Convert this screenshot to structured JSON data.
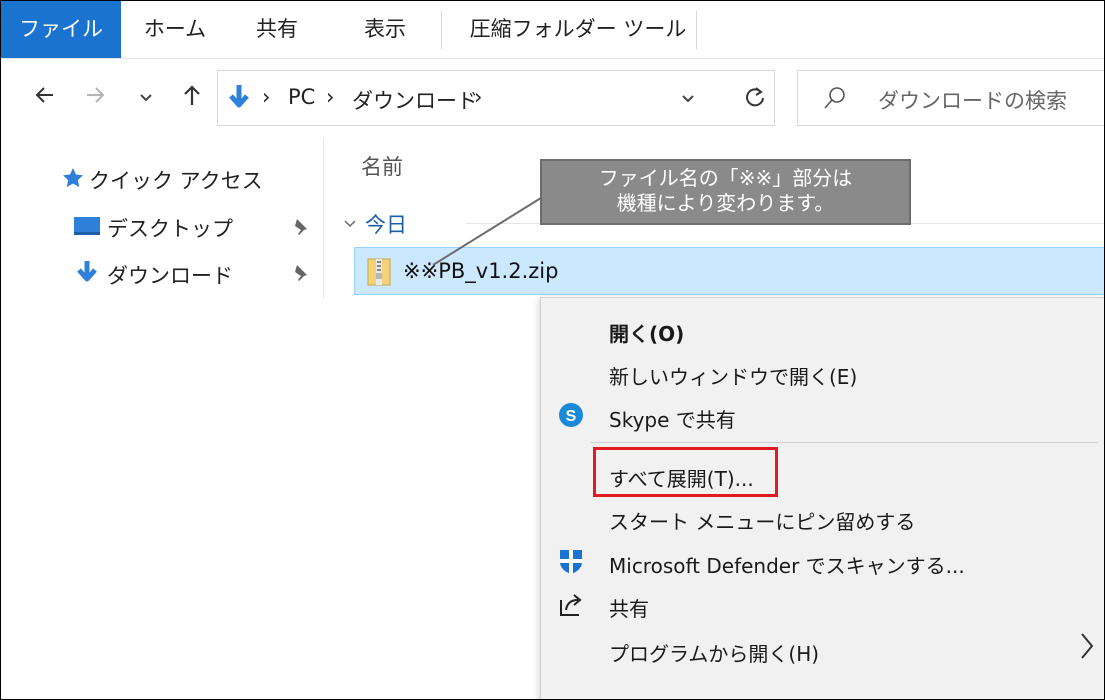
{
  "ribbon": {
    "tabs": [
      {
        "label": "ファイル",
        "active": true
      },
      {
        "label": "ホーム"
      },
      {
        "label": "共有"
      },
      {
        "label": "表示"
      },
      {
        "label": "圧縮フォルダー ツール"
      }
    ]
  },
  "address": {
    "segments": [
      "PC",
      "ダウンロード"
    ],
    "separator": "›",
    "search_placeholder": "ダウンロードの検索"
  },
  "nav_pane": {
    "quick_access": "クイック アクセス",
    "items": [
      {
        "label": "デスクトップ",
        "icon": "desktop-icon",
        "pinned": true
      },
      {
        "label": "ダウンロード",
        "icon": "download-icon",
        "pinned": true
      }
    ]
  },
  "file_list": {
    "column_name": "名前",
    "group_label": "今日",
    "selected_file": "※※PB_v1.2.zip"
  },
  "callout": {
    "line1": "ファイル名の「※※」部分は",
    "line2": "機種により変わります。"
  },
  "context_menu": {
    "items": [
      {
        "label": "開く(O)",
        "bold": true
      },
      {
        "label": "新しいウィンドウで開く(E)"
      },
      {
        "label": "Skype で共有",
        "icon": "skype-icon"
      },
      {
        "label": "すべて展開(T)...",
        "highlighted": true
      },
      {
        "label": "スタート メニューにピン留めする"
      },
      {
        "label": "Microsoft Defender でスキャンする...",
        "icon": "defender-shield-icon"
      },
      {
        "label": "共有",
        "icon": "share-icon"
      },
      {
        "label": "プログラムから開く(H)",
        "has_submenu": true
      }
    ]
  },
  "colors": {
    "accent": "#1a73cf",
    "selection": "#cce8ff",
    "highlight_border": "#e21b23",
    "callout_bg": "#8a8a8a"
  }
}
